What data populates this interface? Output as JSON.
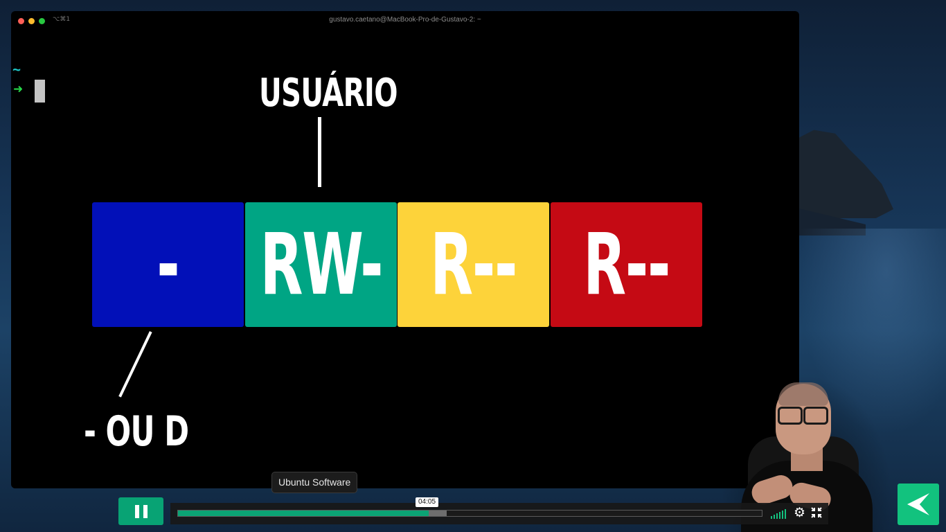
{
  "window": {
    "title": "gustavo.caetano@MacBook-Pro-de-Gustavo-2: ~",
    "shortcut": "⌥⌘1"
  },
  "terminal": {
    "prompt_tilde": "~",
    "prompt_arrow": "➜"
  },
  "diagram": {
    "label_top": "USUÁRIO",
    "label_bottom": "- OU D",
    "boxes": [
      {
        "text": "-",
        "color": "#0210b8"
      },
      {
        "text": "RW-",
        "color": "#00a584"
      },
      {
        "text": "R--",
        "color": "#fdd33a"
      },
      {
        "text": "R--",
        "color": "#c50a14"
      }
    ]
  },
  "player": {
    "tooltip": "Ubuntu Software",
    "current_time": "04:05",
    "progress_fraction": 0.43,
    "buffered_fraction": 0.46,
    "accent_color": "#08a374"
  },
  "icons": {
    "pause": "pause-icon",
    "volume": "volume-icon",
    "settings": "gear-icon",
    "fullscreen": "fullscreen-exit-icon",
    "brand": "brand-logo-icon"
  }
}
